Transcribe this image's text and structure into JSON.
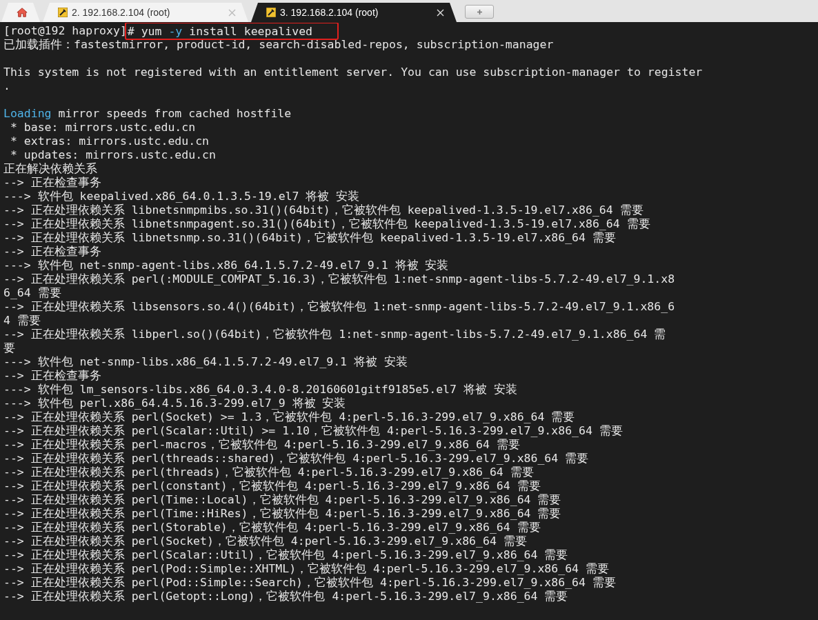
{
  "tabs": [
    {
      "kind": "home",
      "selected": false
    },
    {
      "kind": "session",
      "label": "2. 192.168.2.104 (root)",
      "selected": false
    },
    {
      "kind": "session",
      "label": "3. 192.168.2.104 (root)",
      "selected": true
    },
    {
      "kind": "new"
    }
  ],
  "terminal": {
    "lines": [
      {
        "kind": "command",
        "prompt": "[root@192 haproxy]",
        "highlighted": true,
        "spans": [
          {
            "text": "# yum "
          },
          {
            "text": "-y",
            "color": "#4fb3e8"
          },
          {
            "text": " install keepalived"
          }
        ]
      },
      {
        "kind": "text",
        "text": "已加载插件：fastestmirror, product-id, search-disabled-repos, subscription-manager"
      },
      {
        "kind": "blank"
      },
      {
        "kind": "text",
        "text": "This system is not registered with an entitlement server. You can use subscription-manager to register"
      },
      {
        "kind": "text",
        "text": "."
      },
      {
        "kind": "blank"
      },
      {
        "kind": "spans",
        "spans": [
          {
            "text": "Loading",
            "color": "#4fb3e8"
          },
          {
            "text": " mirror speeds from cached hostfile"
          }
        ]
      },
      {
        "kind": "text",
        "text": " * base: mirrors.ustc.edu.cn"
      },
      {
        "kind": "text",
        "text": " * extras: mirrors.ustc.edu.cn"
      },
      {
        "kind": "text",
        "text": " * updates: mirrors.ustc.edu.cn"
      },
      {
        "kind": "text",
        "text": "正在解决依赖关系"
      },
      {
        "kind": "text",
        "text": "--> 正在检查事务"
      },
      {
        "kind": "text",
        "text": "---> 软件包 keepalived.x86_64.0.1.3.5-19.el7 将被 安装"
      },
      {
        "kind": "text",
        "text": "--> 正在处理依赖关系 libnetsnmpmibs.so.31()(64bit)，它被软件包 keepalived-1.3.5-19.el7.x86_64 需要"
      },
      {
        "kind": "text",
        "text": "--> 正在处理依赖关系 libnetsnmpagent.so.31()(64bit)，它被软件包 keepalived-1.3.5-19.el7.x86_64 需要"
      },
      {
        "kind": "text",
        "text": "--> 正在处理依赖关系 libnetsnmp.so.31()(64bit)，它被软件包 keepalived-1.3.5-19.el7.x86_64 需要"
      },
      {
        "kind": "text",
        "text": "--> 正在检查事务"
      },
      {
        "kind": "text",
        "text": "---> 软件包 net-snmp-agent-libs.x86_64.1.5.7.2-49.el7_9.1 将被 安装"
      },
      {
        "kind": "text",
        "text": "--> 正在处理依赖关系 perl(:MODULE_COMPAT_5.16.3)，它被软件包 1:net-snmp-agent-libs-5.7.2-49.el7_9.1.x8"
      },
      {
        "kind": "text",
        "text": "6_64 需要"
      },
      {
        "kind": "text",
        "text": "--> 正在处理依赖关系 libsensors.so.4()(64bit)，它被软件包 1:net-snmp-agent-libs-5.7.2-49.el7_9.1.x86_6"
      },
      {
        "kind": "text",
        "text": "4 需要"
      },
      {
        "kind": "text",
        "text": "--> 正在处理依赖关系 libperl.so()(64bit)，它被软件包 1:net-snmp-agent-libs-5.7.2-49.el7_9.1.x86_64 需"
      },
      {
        "kind": "text",
        "text": "要"
      },
      {
        "kind": "text",
        "text": "---> 软件包 net-snmp-libs.x86_64.1.5.7.2-49.el7_9.1 将被 安装"
      },
      {
        "kind": "text",
        "text": "--> 正在检查事务"
      },
      {
        "kind": "text",
        "text": "---> 软件包 lm_sensors-libs.x86_64.0.3.4.0-8.20160601gitf9185e5.el7 将被 安装"
      },
      {
        "kind": "text",
        "text": "---> 软件包 perl.x86_64.4.5.16.3-299.el7_9 将被 安装"
      },
      {
        "kind": "text",
        "text": "--> 正在处理依赖关系 perl(Socket) >= 1.3，它被软件包 4:perl-5.16.3-299.el7_9.x86_64 需要"
      },
      {
        "kind": "text",
        "text": "--> 正在处理依赖关系 perl(Scalar::Util) >= 1.10，它被软件包 4:perl-5.16.3-299.el7_9.x86_64 需要"
      },
      {
        "kind": "text",
        "text": "--> 正在处理依赖关系 perl-macros，它被软件包 4:perl-5.16.3-299.el7_9.x86_64 需要"
      },
      {
        "kind": "text",
        "text": "--> 正在处理依赖关系 perl(threads::shared)，它被软件包 4:perl-5.16.3-299.el7_9.x86_64 需要"
      },
      {
        "kind": "text",
        "text": "--> 正在处理依赖关系 perl(threads)，它被软件包 4:perl-5.16.3-299.el7_9.x86_64 需要"
      },
      {
        "kind": "text",
        "text": "--> 正在处理依赖关系 perl(constant)，它被软件包 4:perl-5.16.3-299.el7_9.x86_64 需要"
      },
      {
        "kind": "text",
        "text": "--> 正在处理依赖关系 perl(Time::Local)，它被软件包 4:perl-5.16.3-299.el7_9.x86_64 需要"
      },
      {
        "kind": "text",
        "text": "--> 正在处理依赖关系 perl(Time::HiRes)，它被软件包 4:perl-5.16.3-299.el7_9.x86_64 需要"
      },
      {
        "kind": "text",
        "text": "--> 正在处理依赖关系 perl(Storable)，它被软件包 4:perl-5.16.3-299.el7_9.x86_64 需要"
      },
      {
        "kind": "text",
        "text": "--> 正在处理依赖关系 perl(Socket)，它被软件包 4:perl-5.16.3-299.el7_9.x86_64 需要"
      },
      {
        "kind": "text",
        "text": "--> 正在处理依赖关系 perl(Scalar::Util)，它被软件包 4:perl-5.16.3-299.el7_9.x86_64 需要"
      },
      {
        "kind": "text",
        "text": "--> 正在处理依赖关系 perl(Pod::Simple::XHTML)，它被软件包 4:perl-5.16.3-299.el7_9.x86_64 需要"
      },
      {
        "kind": "text",
        "text": "--> 正在处理依赖关系 perl(Pod::Simple::Search)，它被软件包 4:perl-5.16.3-299.el7_9.x86_64 需要"
      },
      {
        "kind": "text",
        "text": "--> 正在处理依赖关系 perl(Getopt::Long)，它被软件包 4:perl-5.16.3-299.el7_9.x86_64 需要"
      }
    ]
  }
}
